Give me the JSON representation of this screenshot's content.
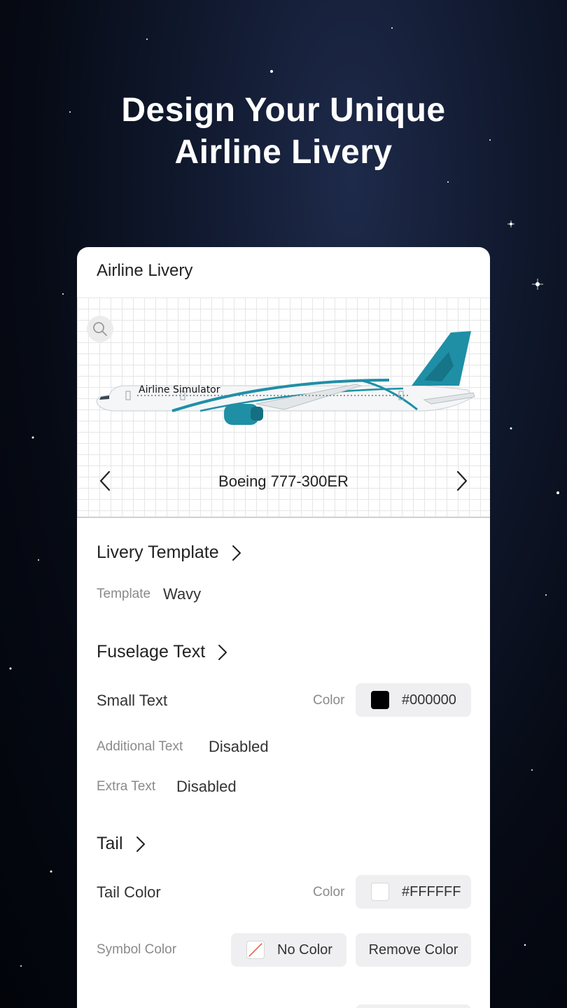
{
  "headline": {
    "line1": "Design Your Unique",
    "line2": "Airline Livery"
  },
  "card": {
    "title": "Airline Livery",
    "preview": {
      "fuselage_text": "Airline Simulator",
      "model": "Boeing 777-300ER",
      "accent_color": "#1f8fa6"
    },
    "livery_template": {
      "heading": "Livery Template",
      "template_label": "Template",
      "template_value": "Wavy"
    },
    "fuselage_text": {
      "heading": "Fuselage Text",
      "small_text_label": "Small Text",
      "color_label": "Color",
      "color_value": "#000000",
      "additional_text_label": "Additional Text",
      "additional_text_value": "Disabled",
      "extra_text_label": "Extra Text",
      "extra_text_value": "Disabled"
    },
    "tail": {
      "heading": "Tail",
      "tail_color_label": "Tail Color",
      "color_label": "Color",
      "color_value": "#FFFFFF",
      "symbol_color_label": "Symbol Color",
      "no_color_label": "No Color",
      "remove_color_label": "Remove Color"
    }
  }
}
